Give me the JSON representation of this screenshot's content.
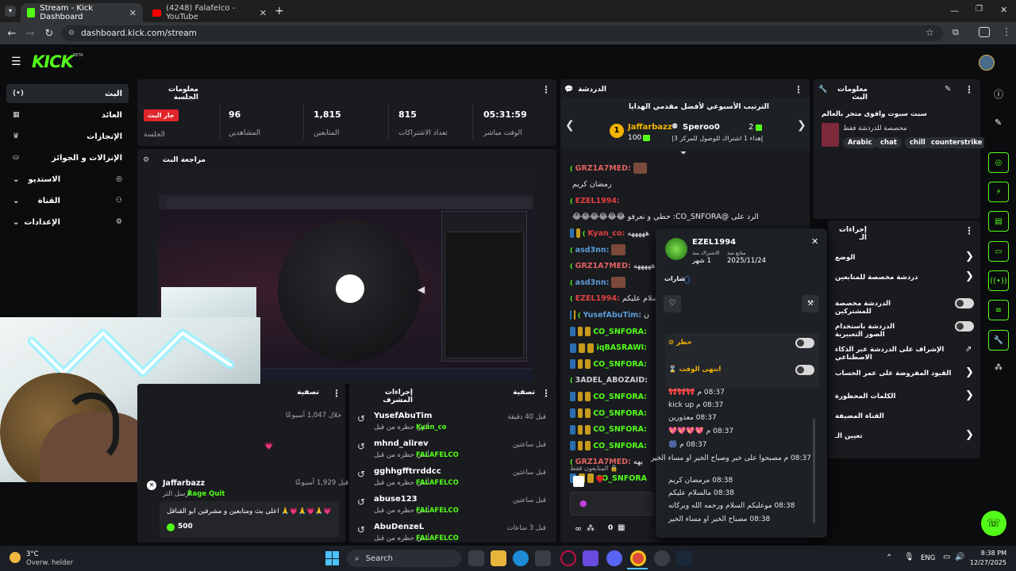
{
  "browser": {
    "tabs": [
      {
        "title": "Stream - Kick Dashboard",
        "active": true
      },
      {
        "title": "(4248) Falafelco - YouTube",
        "active": false
      }
    ],
    "url": "dashboard.kick.com/stream"
  },
  "kick": {
    "logo": "KICK",
    "logo_beta": "BETA",
    "accent": "#53fc18"
  },
  "sidebar": {
    "items": [
      {
        "label": "البث",
        "icon": "broadcast-icon",
        "active": true
      },
      {
        "label": "العائد",
        "icon": "revenue-icon"
      },
      {
        "label": "الإنجازات",
        "icon": "trophy-icon"
      },
      {
        "label": "الإنزالات و الجوائز",
        "icon": "drops-icon"
      },
      {
        "label": "الاستديو",
        "icon": "studio-icon"
      },
      {
        "label": "القناة",
        "icon": "channel-icon"
      },
      {
        "label": "الإعدادات",
        "icon": "gear-icon"
      }
    ]
  },
  "session": {
    "title": "معلومات الجلسة",
    "live_badge": "جار البث",
    "live_label": "الجلسة",
    "stats": [
      {
        "value": "96",
        "label": "المشاهدين"
      },
      {
        "value": "1,815",
        "label": "المتابعين"
      },
      {
        "value": "815",
        "label": "تعداد الاشتراكات"
      },
      {
        "value": "05:31:59",
        "label": "الوقت مباشر"
      }
    ]
  },
  "preview": {
    "title": "مراجعة البث"
  },
  "activity": {
    "title": "تصفية",
    "first_time": "خلال 1,047 أسبوعًا",
    "gift_user": "Jaffarbazz",
    "gift_time": "قبل 1,929 أسبوعًا",
    "gift_sub": "أرسل الثر",
    "gift_item": "Rage Quit",
    "gift_msg": "اعلى بث ومتابعين و مشرفين ابو القناقل",
    "gift_amount": "500"
  },
  "mod_actions": {
    "title": "إجراءات المشرف",
    "filter": "تصفية",
    "items": [
      {
        "user": "YusefAbuTim",
        "action": "ألغي حظره من قبل",
        "by": "Kyan_co",
        "time": "قبل 40 دقيقة"
      },
      {
        "user": "mhnd_alirev",
        "action": "ألغي حظره من قبل",
        "by": "FALAFELCO",
        "time": "قبل ساعتين"
      },
      {
        "user": "gghhgfftrrddcc",
        "action": "ألغي حظره من قبل",
        "by": "FALAFELCO",
        "time": "قبل ساعتين"
      },
      {
        "user": "abuse123",
        "action": "ألغي حظره من قبل",
        "by": "FALAFELCO",
        "time": "قبل ساعتين"
      },
      {
        "user": "AbuDenzeL",
        "action": "ألغي حظره من قبل",
        "by": "FALAFELCO",
        "time": "قبل 3 ساعات"
      }
    ]
  },
  "chat": {
    "title": "الدردشة",
    "leaderboard_title": "الترتيب الأسبوعي لأفضل مقدمي الهدايا",
    "top1": {
      "rank": "1",
      "name": "Jaffarbazz",
      "count": "100"
    },
    "top2": {
      "rank": "2",
      "name": "Speroo0"
    },
    "top2_sub": "إهداء 1 اشتراك للوصول للمركز 3|",
    "messages": [
      {
        "user": "GRZ1A7MED:",
        "text": "",
        "color": "#e06060",
        "badges": "av"
      },
      {
        "user": "",
        "text": "رمضان كريم",
        "color": "#e06060",
        "badges": ""
      },
      {
        "user": "EZEL1994:",
        "text": "",
        "color": "#e04040",
        "badges": ""
      },
      {
        "user": "",
        "text": "الرد على @CO_SNFORA: حطي و نعرفو 😂😂😂😂😂😂",
        "color": "#aaa",
        "badges": ""
      },
      {
        "user": "Kyan_co:",
        "text": "هههههه",
        "color": "#e04040",
        "badges": "bg"
      },
      {
        "user": "asd3nn:",
        "text": "",
        "color": "#5b9bd5",
        "badges": "av"
      },
      {
        "user": "GRZ1A7MED:",
        "text": "هههههه",
        "color": "#e06060",
        "badges": ""
      },
      {
        "user": "asd3nn:",
        "text": "",
        "color": "#5b9bd5",
        "badges": "av"
      },
      {
        "user": "EZEL1994:",
        "text": "السلام عليكم",
        "color": "#e04040",
        "badges": ""
      },
      {
        "user": "YusefAbuTim:",
        "text": "ن",
        "color": "#5b9bd5",
        "badges": "bg"
      },
      {
        "user": "CO_SNFORA:",
        "text": "",
        "color": "#53fc18",
        "badges": "bgg"
      },
      {
        "user": "iqBASRAWI:",
        "text": "",
        "color": "#53fc18",
        "badges": "bgg"
      },
      {
        "user": "CO_SNFORA:",
        "text": "",
        "color": "#53fc18",
        "badges": "bgg"
      },
      {
        "user": "3ADEL_ABOZAID:",
        "text": "",
        "color": "#cccccc",
        "badges": ""
      },
      {
        "user": "CO_SNFORA:",
        "text": "",
        "color": "#53fc18",
        "badges": "bgg"
      },
      {
        "user": "CO_SNFORA:",
        "text": "",
        "color": "#53fc18",
        "badges": "bgg"
      },
      {
        "user": "CO_SNFORA:",
        "text": "",
        "color": "#53fc18",
        "badges": "bgg"
      },
      {
        "user": "CO_SNFORA:",
        "text": "",
        "color": "#53fc18",
        "badges": "bgg"
      },
      {
        "user": "GRZ1A7MED:",
        "text": "بهه",
        "color": "#e06060",
        "badges": ""
      },
      {
        "user": "CO_SNFORA",
        "text": "",
        "color": "#53fc18",
        "badges": "bgg"
      }
    ],
    "followers_only": "المتابعون فقط",
    "input_count": "0"
  },
  "user_popup": {
    "name": "EZEL1994",
    "sub_label": "الاشتراك منذ",
    "sub_value": "1 شهر",
    "follow_label": "متابع منذ",
    "follow_value": "2025/11/24",
    "badges_label": "شارات",
    "ban_label": "حظر",
    "timeout_label": "انتهى الوقت",
    "messages": [
      "08:37 م 🎀🎀🎀",
      "08:37 م kick up",
      "08:37 معذورين",
      "08:37 م 💖💖💖💖",
      "08:37 م 🎆",
      "08:37 م مصبحوا على خير وصباح الخير او مساء الخير",
      "08:38 مرمضان كريم",
      "08:38 مالسلام عليكم",
      "08:38 موعليكم السلام ورحمه الله وبركاته",
      "08:38 مصباح الخير او مساء الخير"
    ]
  },
  "stream_info": {
    "title": "معلومات البث",
    "stream_title": "سبت سبوت واقوى متجر بالعالم",
    "category_sub": "مخصصة للدردشة فقط",
    "tags": [
      "Arabic",
      "chat",
      "chill",
      "counterstrike"
    ]
  },
  "mod_settings": {
    "title": "إجراءات الـ",
    "rows": [
      {
        "label": "الوضع",
        "type": "chevron"
      },
      {
        "label": "دردشة مخصصة للمتابعين",
        "type": "chevron"
      },
      {
        "label": "الدردشة مخصصة للمشتركين",
        "type": "toggle"
      },
      {
        "label": "الدردشة باستخدام الصور التعبيرية",
        "type": "toggle"
      },
      {
        "label": "الإشراف على الدردشة عبر الذكاء الاصطناعي",
        "type": "link"
      },
      {
        "label": "القيود المفروضة على عمر الحساب",
        "type": "chevron"
      },
      {
        "label": "الكلمات المحظورة",
        "type": "chevron"
      },
      {
        "label": "القناة المضيفة",
        "type": "none"
      },
      {
        "label": "تعيين الـ",
        "type": "chevron"
      }
    ]
  },
  "taskbar": {
    "weather_temp": "3°C",
    "weather_desc": "Overw. helder",
    "search": "Search",
    "lang": "ENG",
    "time": "8:38 PM",
    "date": "12/27/2025"
  }
}
